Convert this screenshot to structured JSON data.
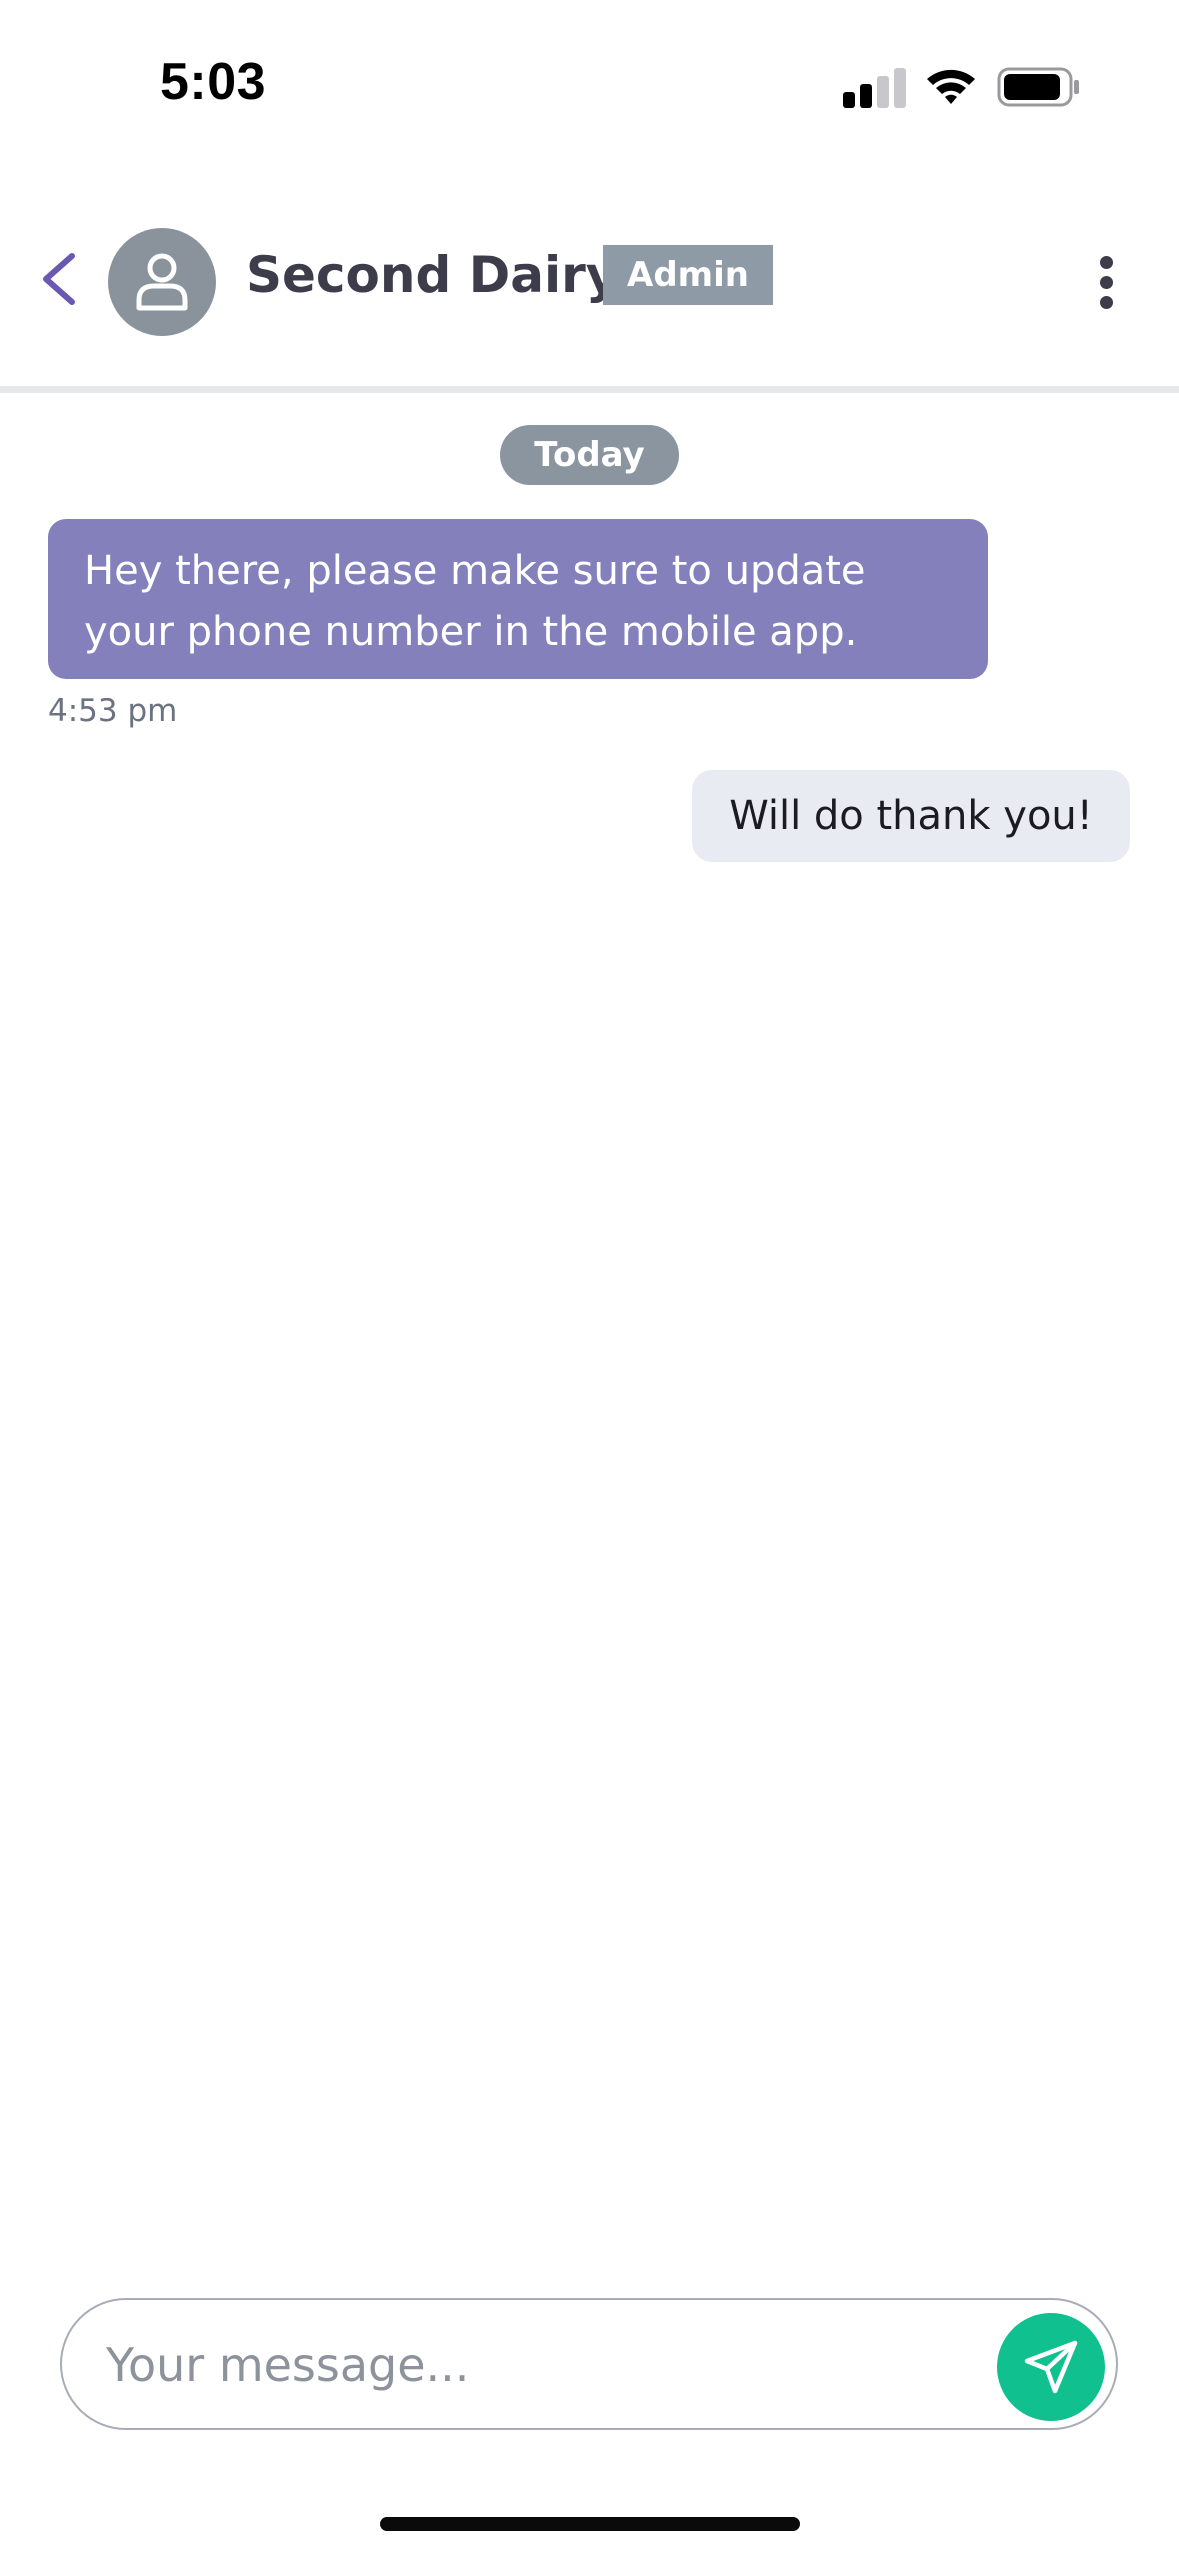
{
  "status_bar": {
    "time": "5:03",
    "icons": [
      "cellular-signal-icon",
      "wifi-icon",
      "battery-icon"
    ]
  },
  "header": {
    "back_icon": "chevron-left-icon",
    "avatar_icon": "user-icon",
    "chat_name": "Second Dairy",
    "role_badge": "Admin",
    "menu_icon": "more-vertical-icon"
  },
  "conversation": {
    "date_divider": "Today",
    "messages": [
      {
        "direction": "incoming",
        "text": "Hey there, please make sure to update your phone number in the mobile app.",
        "time": "4:53 pm"
      },
      {
        "direction": "outgoing",
        "text": "Will do thank you!"
      }
    ]
  },
  "composer": {
    "placeholder": "Your message...",
    "value": "",
    "send_icon": "send-icon"
  },
  "colors": {
    "accent_purple": "#6b58b0",
    "incoming_bubble": "#8380bb",
    "outgoing_bubble": "#e8ecf2",
    "badge_gray": "#8e9aa5",
    "send_green": "#11c08f"
  }
}
